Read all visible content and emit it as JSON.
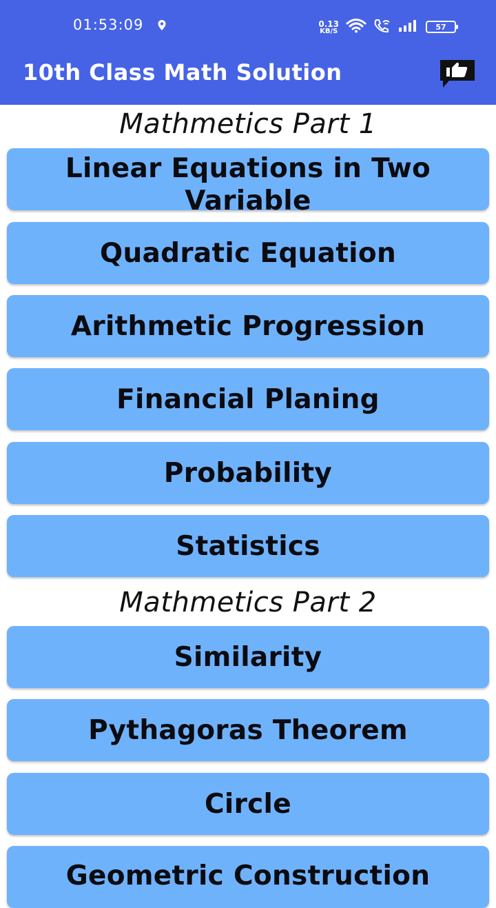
{
  "status_bar": {
    "time": "01:53:09",
    "net_speed_value": "0.13",
    "net_speed_unit": "KB/S",
    "battery": "57"
  },
  "app_bar": {
    "title": "10th Class Math Solution",
    "feedback_icon": "thumbs-up-chat-icon"
  },
  "sections": [
    {
      "title": "Mathmetics Part 1",
      "chapters": [
        "Linear Equations in Two Variable",
        "Quadratic Equation",
        "Arithmetic Progression",
        "Financial Planing",
        "Probability",
        "Statistics"
      ]
    },
    {
      "title": "Mathmetics Part 2",
      "chapters": [
        "Similarity",
        "Pythagoras Theorem",
        "Circle",
        "Geometric Construction"
      ]
    }
  ],
  "colors": {
    "app_bar": "#4663e6",
    "chapter_button": "#6fb2fc",
    "background": "#ffffff"
  }
}
